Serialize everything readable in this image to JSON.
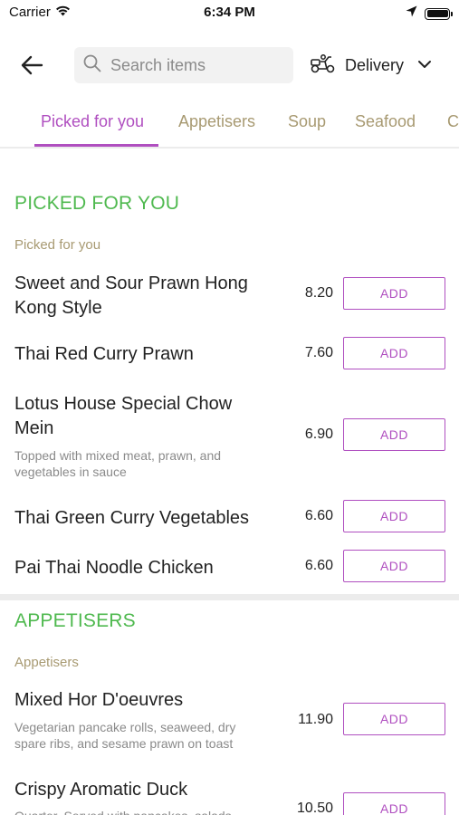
{
  "status_bar": {
    "carrier": "Carrier",
    "time": "6:34 PM"
  },
  "search": {
    "placeholder": "Search items"
  },
  "delivery": {
    "label": "Delivery"
  },
  "tabs": [
    {
      "label": "Picked for you",
      "active": true
    },
    {
      "label": "Appetisers"
    },
    {
      "label": "Soup"
    },
    {
      "label": "Seafood"
    },
    {
      "label": "C"
    }
  ],
  "sections": [
    {
      "title": "PICKED FOR YOU",
      "subtitle": "Picked for you",
      "items": [
        {
          "name_line1": "Sweet and Sour Prawn Hong",
          "name_line2": "Kong Style",
          "price": "8.20",
          "add_label": "ADD"
        },
        {
          "name": "Thai Red Curry Prawn",
          "price": "7.60",
          "add_label": "ADD"
        },
        {
          "name_line1": "Lotus House Special Chow",
          "name_line2": "Mein",
          "desc_line1": "Topped with mixed meat, prawn, and",
          "desc_line2": "vegetables in sauce",
          "price": "6.90",
          "add_label": "ADD"
        },
        {
          "name": "Thai Green Curry Vegetables",
          "price": "6.60",
          "add_label": "ADD"
        },
        {
          "name": "Pai Thai Noodle Chicken",
          "price": "6.60",
          "add_label": "ADD"
        }
      ]
    },
    {
      "title": "APPETISERS",
      "subtitle": "Appetisers",
      "items": [
        {
          "name": "Mixed Hor D'oeuvres",
          "desc_line1": "Vegetarian pancake rolls, seaweed, dry",
          "desc_line2": "spare ribs, and sesame prawn on toast",
          "price": "11.90",
          "add_label": "ADD"
        },
        {
          "name": "Crispy Aromatic Duck",
          "desc_line1": "Quarter. Served with pancakes, salads",
          "price": "10.50",
          "add_label": "ADD"
        }
      ]
    }
  ],
  "colors": {
    "accent": "#b04fc0",
    "section_green": "#4fb94f",
    "tab_text": "#a89a72"
  }
}
